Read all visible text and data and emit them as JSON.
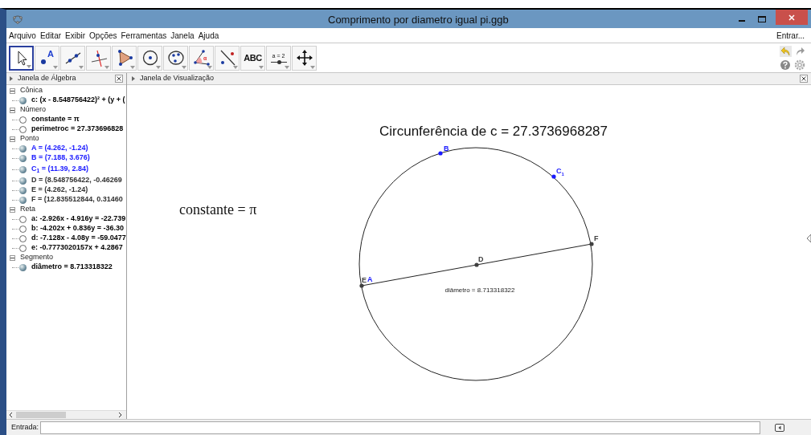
{
  "window": {
    "title": "Comprimento por diametro igual pi.ggb"
  },
  "menu": [
    "Arquivo",
    "Editar",
    "Exibir",
    "Opções",
    "Ferramentas",
    "Janela",
    "Ajuda"
  ],
  "login": "Entrar...",
  "toolbar": {
    "tools": [
      {
        "kind": "move",
        "selected": true
      },
      {
        "kind": "point",
        "label": "A",
        "selected": false
      },
      {
        "kind": "line",
        "selected": false
      },
      {
        "kind": "perpendicular",
        "selected": false
      },
      {
        "kind": "polygon",
        "selected": false
      },
      {
        "kind": "circle-center",
        "selected": false
      },
      {
        "kind": "circle-three",
        "selected": false
      },
      {
        "kind": "angle",
        "label": "α",
        "selected": false
      },
      {
        "kind": "reflect",
        "selected": false
      },
      {
        "kind": "text",
        "label": "ABC",
        "selected": false
      },
      {
        "kind": "slider",
        "label": "a = 2",
        "selected": false
      },
      {
        "kind": "move-view",
        "selected": false
      }
    ]
  },
  "algebra": {
    "title": "Janela de Álgebra",
    "groups": [
      {
        "label": "Cônica",
        "expanded": true,
        "children": [
          {
            "text": "c: (x - 8.548756422)² + (y + (",
            "shown": true,
            "color": "#000000"
          }
        ]
      },
      {
        "label": "Número",
        "expanded": true,
        "children": [
          {
            "text": "constante = π",
            "shown": false,
            "color": "#000000"
          },
          {
            "text": "perimetroc = 27.373696828",
            "shown": false,
            "color": "#000000"
          }
        ]
      },
      {
        "label": "Ponto",
        "expanded": true,
        "children": [
          {
            "text": "A = (4.262, -1.24)",
            "shown": true,
            "color": "#1a1aff"
          },
          {
            "text": "B = (7.188, 3.676)",
            "shown": true,
            "color": "#1a1aff"
          },
          {
            "text": "C$_{1}$ = (11.39, 2.84)",
            "shown": true,
            "color": "#1a1aff"
          },
          {
            "text": "D = (8.548756422, -0.46269",
            "shown": true,
            "color": "#333333"
          },
          {
            "text": "E = (4.262, -1.24)",
            "shown": true,
            "color": "#333333"
          },
          {
            "text": "F = (12.835512844, 0.31460",
            "shown": true,
            "color": "#333333"
          }
        ]
      },
      {
        "label": "Reta",
        "expanded": true,
        "children": [
          {
            "text": "a: -2.926x - 4.916y = -22.739",
            "shown": false,
            "color": "#000000"
          },
          {
            "text": "b: -4.202x + 0.836y = -36.30",
            "shown": false,
            "color": "#000000"
          },
          {
            "text": "d: -7.128x - 4.08y = -59.0477",
            "shown": false,
            "color": "#000000"
          },
          {
            "text": "e: -0.7773020157x + 4.2867",
            "shown": false,
            "color": "#000000"
          }
        ]
      },
      {
        "label": "Segmento",
        "expanded": true,
        "children": [
          {
            "text": "diâmetro = 8.713318322",
            "shown": true,
            "color": "#000000"
          }
        ]
      }
    ]
  },
  "graphics": {
    "title": "Janela de Visualização",
    "caption": "Circunferência de c = 27.3736968287",
    "formula": "constante = π",
    "segment_label": "diâmetro = 8.713318322",
    "points": [
      {
        "label": "B",
        "color": "#1a1aff"
      },
      {
        "label": "C$_{1}$",
        "color": "#1a1aff"
      },
      {
        "label": "F",
        "color": "#404040"
      },
      {
        "label": "D",
        "color": "#404040"
      },
      {
        "label": "E",
        "color": "#404040"
      },
      {
        "label": "A",
        "color": "#1a1aff"
      }
    ]
  },
  "input_bar": {
    "label": "Entrada:"
  }
}
